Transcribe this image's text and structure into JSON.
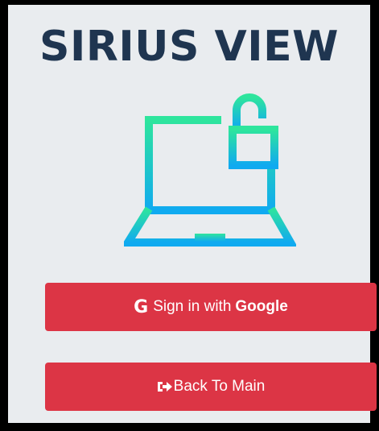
{
  "app": {
    "title": "SIRIUS VIEW"
  },
  "logo": {
    "icon": "laptop-unlocked-padlock-icon",
    "gradient": [
      "#2ee59d",
      "#10aaf0"
    ]
  },
  "buttons": {
    "google": {
      "icon_glyph": "G",
      "label_prefix": "Sign in with",
      "label_brand": "Google"
    },
    "back": {
      "icon": "sign-out-icon",
      "label": "Back To Main"
    }
  },
  "colors": {
    "background": "#e9ecef",
    "title": "#1f3550",
    "button": "#dc3545",
    "frame": "#000000"
  }
}
